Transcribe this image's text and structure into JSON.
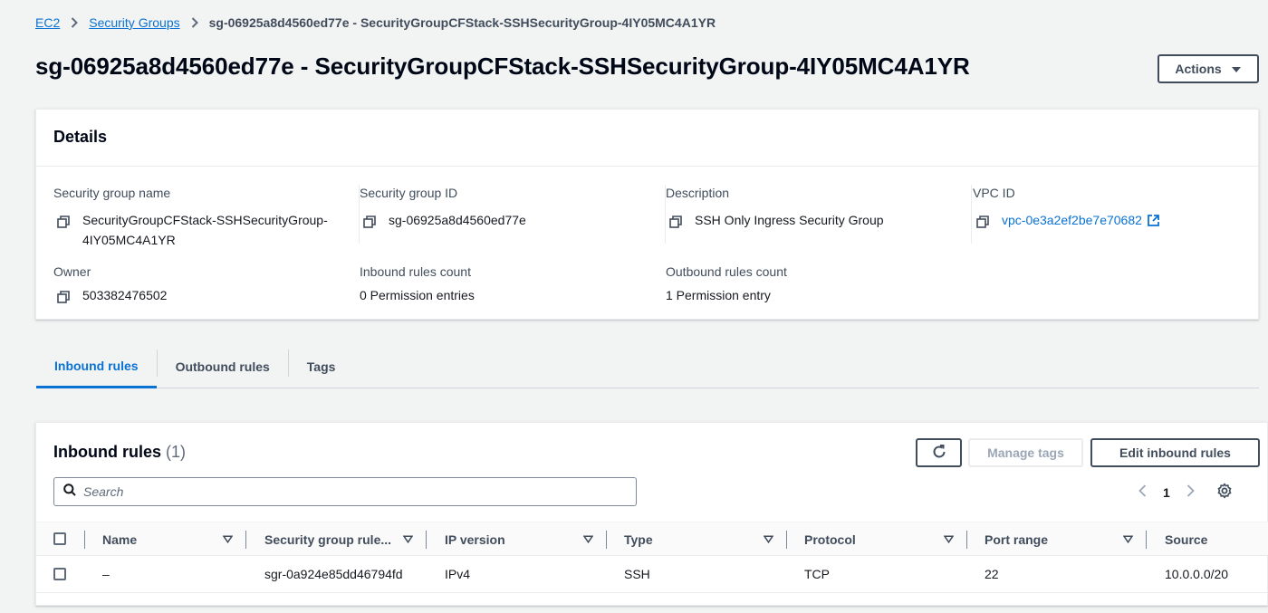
{
  "breadcrumb": {
    "items": [
      "EC2",
      "Security Groups"
    ],
    "current": "sg-06925a8d4560ed77e - SecurityGroupCFStack-SSHSecurityGroup-4IY05MC4A1YR"
  },
  "page": {
    "title": "sg-06925a8d4560ed77e - SecurityGroupCFStack-SSHSecurityGroup-4IY05MC4A1YR",
    "actions_label": "Actions"
  },
  "details": {
    "heading": "Details",
    "sg_name_label": "Security group name",
    "sg_name_value": "SecurityGroupCFStack-SSHSecurityGroup-4IY05MC4A1YR",
    "sg_id_label": "Security group ID",
    "sg_id_value": "sg-06925a8d4560ed77e",
    "description_label": "Description",
    "description_value": "SSH Only Ingress Security Group",
    "vpc_label": "VPC ID",
    "vpc_value": "vpc-0e3a2ef2be7e70682",
    "owner_label": "Owner",
    "owner_value": "503382476502",
    "inbound_count_label": "Inbound rules count",
    "inbound_count_value": "0 Permission entries",
    "outbound_count_label": "Outbound rules count",
    "outbound_count_value": "1 Permission entry"
  },
  "tabs": [
    "Inbound rules",
    "Outbound rules",
    "Tags"
  ],
  "inbound": {
    "title": "Inbound rules",
    "count": "(1)",
    "manage_tags_label": "Manage tags",
    "edit_label": "Edit inbound rules",
    "search_placeholder": "Search",
    "page_number": "1",
    "columns": [
      "Name",
      "Security group rule...",
      "IP version",
      "Type",
      "Protocol",
      "Port range",
      "Source"
    ],
    "rows": [
      [
        "–",
        "sgr-0a924e85dd46794fd",
        "IPv4",
        "SSH",
        "TCP",
        "22",
        "10.0.0.0/20"
      ]
    ]
  },
  "colors": {
    "link": "#0972d3",
    "border_dark": "#414d5c",
    "background": "#f2f3f3"
  }
}
